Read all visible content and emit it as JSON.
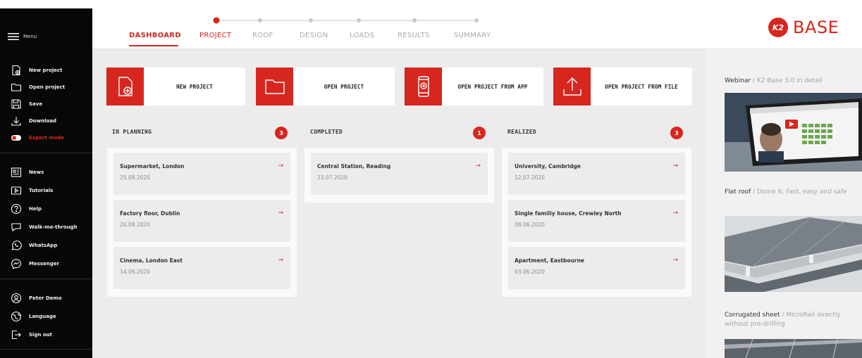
{
  "sidebar": {
    "menu_label": "Menu",
    "items": [
      {
        "label": "New project",
        "icon": "new-project-icon"
      },
      {
        "label": "Open project",
        "icon": "folder-icon"
      },
      {
        "label": "Save",
        "icon": "save-icon"
      },
      {
        "label": "Download",
        "icon": "download-icon"
      },
      {
        "label": "Expert mode",
        "icon": "toggle-icon"
      },
      {
        "label": "News",
        "icon": "news-icon"
      },
      {
        "label": "Tutorials",
        "icon": "play-icon"
      },
      {
        "label": "Help",
        "icon": "help-icon"
      },
      {
        "label": "Walk-me-through",
        "icon": "speech-bubble-icon"
      },
      {
        "label": "WhatsApp",
        "icon": "whatsapp-icon"
      },
      {
        "label": "Messenger",
        "icon": "messenger-icon"
      },
      {
        "label": "Peter Demo",
        "icon": "user-icon"
      },
      {
        "label": "Language",
        "icon": "globe-icon"
      },
      {
        "label": "Sign out",
        "icon": "sign-out-icon"
      }
    ]
  },
  "nav": {
    "tabs": [
      "DASHBOARD",
      "PROJECT",
      "ROOF",
      "DESIGN",
      "LOADS",
      "RESULTS",
      "SUMMARY"
    ]
  },
  "logo": {
    "text": "BASE",
    "badge": "K2"
  },
  "actions": [
    {
      "label": "NEW PROJECT"
    },
    {
      "label": "OPEN PROJECT"
    },
    {
      "label": "OPEN PROJECT FROM APP"
    },
    {
      "label": "OPEN PROJECT FROM FILE"
    }
  ],
  "columns": [
    {
      "title": "IN PLANNING",
      "count": "3",
      "cards": [
        {
          "title": "Supermarket, London",
          "date": "25.08.2020"
        },
        {
          "title": "Factory floor, Dublin",
          "date": "20.08.2020"
        },
        {
          "title": "Cinema, London East",
          "date": "14.06.2020"
        }
      ]
    },
    {
      "title": "COMPLETED",
      "count": "1",
      "cards": [
        {
          "title": "Central Station, Reading",
          "date": "23.07.2020"
        }
      ]
    },
    {
      "title": "REALIZED",
      "count": "3",
      "cards": [
        {
          "title": "University, Cambridge",
          "date": "12.07.2020"
        },
        {
          "title": "Single familiy house, Crewley North",
          "date": "08.06.2020"
        },
        {
          "title": "Apartment, Eastbourne",
          "date": "03.06.2020"
        }
      ]
    }
  ],
  "card_arrow": "→",
  "news": [
    {
      "title": "Webinar",
      "sub": "K2 Base 3.0 in detail"
    },
    {
      "title": "Flat roof",
      "sub": "Dome 6: Fast, easy and safe"
    },
    {
      "title": "Corrugated sheet",
      "sub": "MicroRail directly without pre-drilling"
    }
  ],
  "news_separator": " / ",
  "colors": {
    "accent": "#d7261e",
    "sidebar": "#070707",
    "background": "#ececec"
  }
}
